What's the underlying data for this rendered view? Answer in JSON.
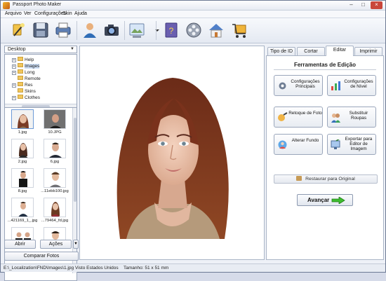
{
  "window": {
    "title": "Passport Photo Maker"
  },
  "menu": [
    "Arquivo",
    "Ver",
    "Configurações",
    "Skin",
    "Ajuda"
  ],
  "left": {
    "folder": "Desktop",
    "tree": [
      "Help",
      "Images",
      "Long",
      "Remote",
      "Res",
      "Skins",
      "Clothes"
    ],
    "thumbs": [
      {
        "caption": "1.jpg"
      },
      {
        "caption": "10.JPG"
      },
      {
        "caption": "2.jpg"
      },
      {
        "caption": "6.jpg"
      },
      {
        "caption": "8.jpg"
      },
      {
        "caption": "...11ebb100.jpg"
      },
      {
        "caption": "...421169_1_.jpg"
      },
      {
        "caption": "...79464_fd.jpg"
      }
    ],
    "open": "Abrir",
    "actions": "Ações",
    "compare": "Comparar Fotos"
  },
  "tabs": [
    "Tipo de ID",
    "Cortar",
    "Editar",
    "Imprimir"
  ],
  "edit": {
    "title": "Ferramentas de Edição",
    "buttons": [
      {
        "label": "Configurações Principais",
        "icon": "gear-icon"
      },
      {
        "label": "Configurações de Nível",
        "icon": "levels-icon"
      },
      {
        "label": "Retoque de Foto",
        "icon": "retouch-icon"
      },
      {
        "label": "Substituir Roupas",
        "icon": "clothes-icon"
      },
      {
        "label": "Alterar Fundo",
        "icon": "background-icon"
      },
      {
        "label": "Exportar para Editor de Imagem",
        "icon": "export-icon"
      }
    ],
    "restore": "Restaurar para Original",
    "next": "Avançar"
  },
  "status": {
    "path": "E:\\_Localization\\FND\\Images\\1.jpg",
    "standard": "Visto Estados Unidos",
    "size": "Tamanho: 51 x 51 mm"
  }
}
